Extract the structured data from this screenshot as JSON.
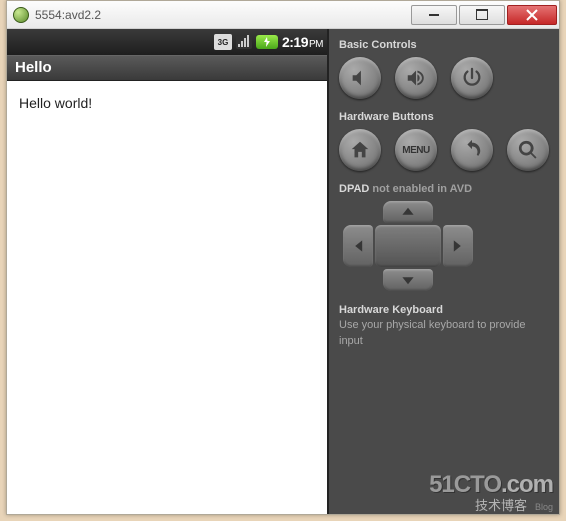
{
  "window": {
    "title": "5554:avd2.2"
  },
  "statusbar": {
    "net": "3G",
    "time": "2:19",
    "ampm": "PM"
  },
  "app": {
    "header": "Hello",
    "body": "Hello world!"
  },
  "panel": {
    "basic_label": "Basic Controls",
    "hw_label": "Hardware Buttons",
    "menu_label": "MENU",
    "dpad_label": "DPAD",
    "dpad_status": "not enabled in AVD",
    "hkb_title": "Hardware Keyboard",
    "hkb_desc": "Use your physical keyboard to provide input"
  },
  "watermark": {
    "brand": "51CTO",
    "suffix": ".com",
    "cn": "技术博客",
    "tag": "Blog"
  }
}
